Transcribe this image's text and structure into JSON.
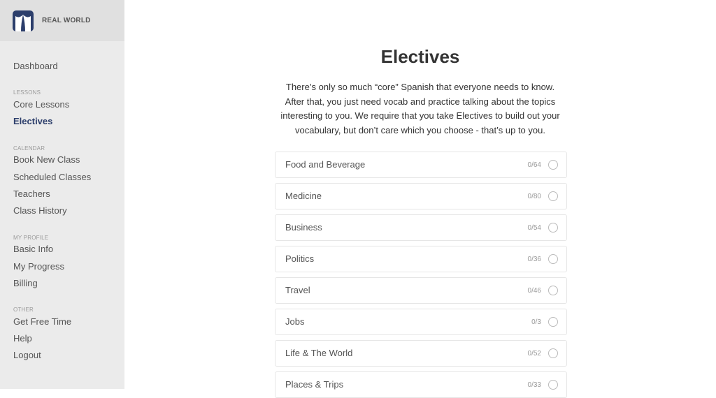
{
  "brand": {
    "name": "REAL WORLD",
    "logo_icon": "real-world-logo-icon",
    "color": "#2c3e6b"
  },
  "sidebar": {
    "dashboard": "Dashboard",
    "sections": [
      {
        "heading": "LESSONS",
        "items": [
          {
            "label": "Core Lessons"
          },
          {
            "label": "Electives",
            "active": true
          }
        ]
      },
      {
        "heading": "CALENDAR",
        "items": [
          {
            "label": "Book New Class"
          },
          {
            "label": "Scheduled Classes"
          },
          {
            "label": "Teachers"
          },
          {
            "label": "Class History"
          }
        ]
      },
      {
        "heading": "MY PROFILE",
        "items": [
          {
            "label": "Basic Info"
          },
          {
            "label": "My Progress"
          },
          {
            "label": "Billing"
          }
        ]
      },
      {
        "heading": "OTHER",
        "items": [
          {
            "label": "Get Free Time"
          },
          {
            "label": "Help"
          },
          {
            "label": "Logout"
          }
        ]
      }
    ]
  },
  "main": {
    "title": "Electives",
    "intro": "There’s only so much “core” Spanish that everyone needs to know. After that, you just need vocab and practice talking about the topics interesting to you. We require that you take Electives to build out your vocabulary, but don’t care which you choose - that’s up to you.",
    "electives": [
      {
        "label": "Food and Beverage",
        "count": "0/64"
      },
      {
        "label": "Medicine",
        "count": "0/80"
      },
      {
        "label": "Business",
        "count": "0/54"
      },
      {
        "label": "Politics",
        "count": "0/36"
      },
      {
        "label": "Travel",
        "count": "0/46"
      },
      {
        "label": "Jobs",
        "count": "0/3"
      },
      {
        "label": "Life & The World",
        "count": "0/52"
      },
      {
        "label": "Places & Trips",
        "count": "0/33"
      }
    ]
  }
}
